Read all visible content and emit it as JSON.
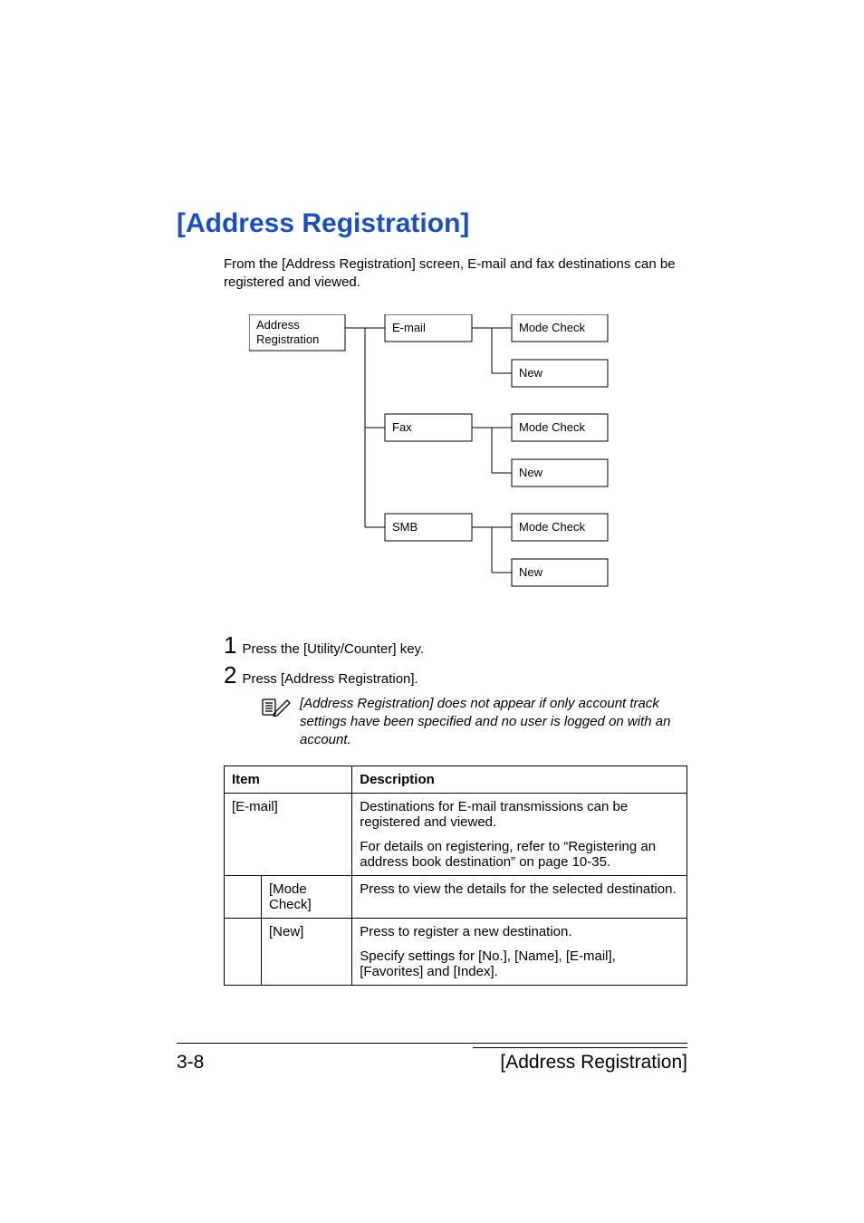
{
  "title": "[Address Registration]",
  "intro": "From the [Address Registration] screen, E-mail and fax destinations can be registered and viewed.",
  "diagram": {
    "root": "Address\nRegistration",
    "branches": [
      {
        "label": "E-mail",
        "children": [
          "Mode Check",
          "New"
        ]
      },
      {
        "label": "Fax",
        "children": [
          "Mode Check",
          "New"
        ]
      },
      {
        "label": "SMB",
        "children": [
          "Mode Check",
          "New"
        ]
      }
    ]
  },
  "steps": [
    "Press the [Utility/Counter] key.",
    "Press [Address Registration]."
  ],
  "note": "[Address Registration] does not appear if only account track settings have been specified and no user is logged on with an account.",
  "table": {
    "headers": [
      "Item",
      "Description"
    ],
    "rows": [
      {
        "item": "[E-mail]",
        "indent": false,
        "desc": [
          "Destinations for E-mail transmissions can be registered and viewed.",
          "For details on registering, refer to “Registering an address book destination” on page 10-35."
        ]
      },
      {
        "item": "[Mode Check]",
        "indent": true,
        "desc": [
          "Press to view the details for the selected destination."
        ]
      },
      {
        "item": "[New]",
        "indent": true,
        "desc": [
          "Press to register a new destination.",
          "Specify settings for [No.], [Name], [E-mail], [Favorites] and [Index]."
        ]
      }
    ]
  },
  "footer": {
    "left": "3-8",
    "right": "[Address Registration]"
  }
}
